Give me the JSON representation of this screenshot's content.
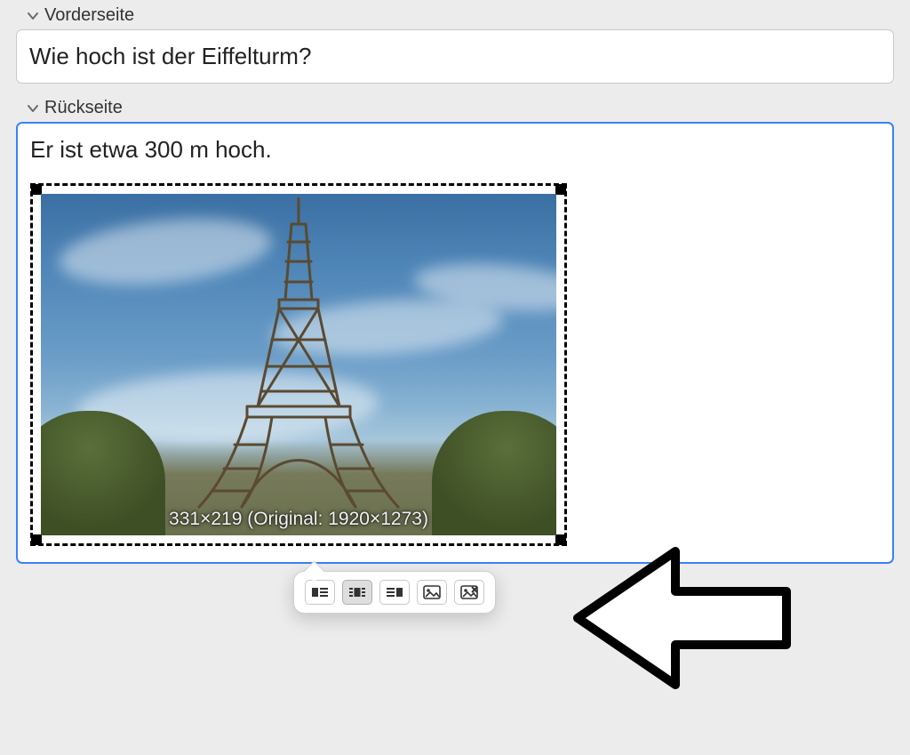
{
  "front": {
    "label": "Vorderseite",
    "value": "Wie hoch ist der Eiffelturm?"
  },
  "back": {
    "label": "Rückseite",
    "text": "Er ist etwa 300 m hoch.",
    "image": {
      "display_width": 331,
      "display_height": 219,
      "original_width": 1920,
      "original_height": 1273,
      "overlay_label": "331×219 (Original: 1920×1273)"
    }
  },
  "toolbar_names": {
    "align_left": "align-left",
    "align_center": "align-center",
    "align_right": "align-right",
    "image_options": "image-options",
    "image_remove": "image-remove"
  }
}
